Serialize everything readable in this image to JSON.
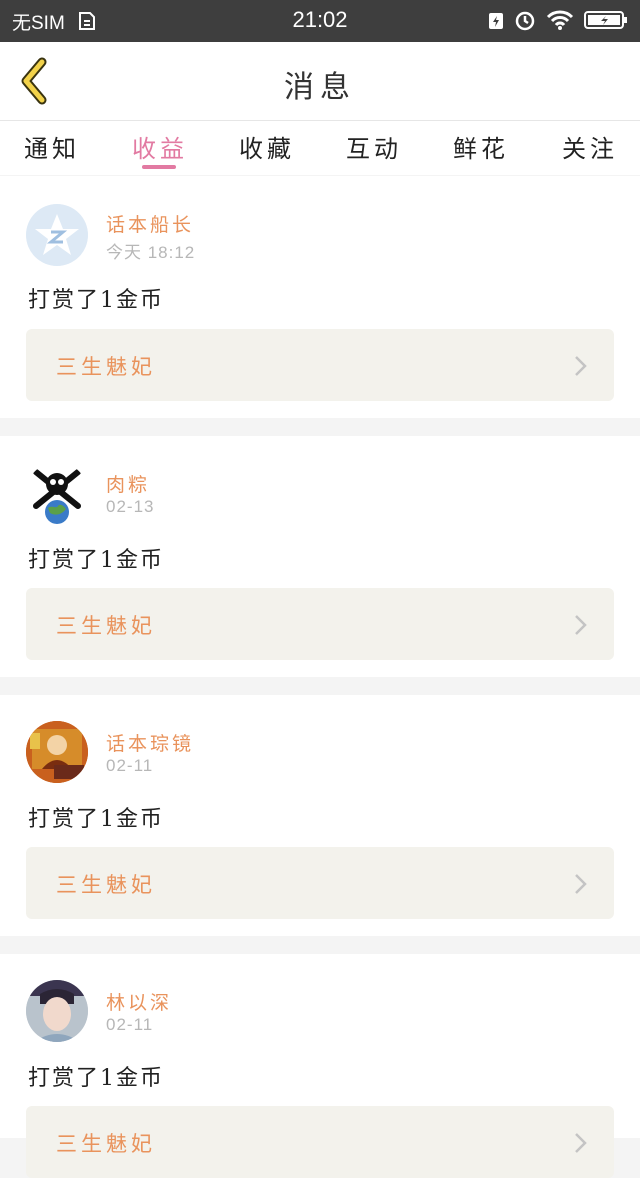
{
  "status_bar": {
    "carrier": "无SIM",
    "time": "21:02"
  },
  "header": {
    "title": "消息"
  },
  "tabs": [
    {
      "label": "通知"
    },
    {
      "label": "收益"
    },
    {
      "label": "收藏"
    },
    {
      "label": "互动"
    },
    {
      "label": "鲜花"
    },
    {
      "label": "关注"
    }
  ],
  "active_tab_index": 1,
  "messages": [
    {
      "user": "话本船长",
      "time": "今天 18:12",
      "text": "打赏了1金币",
      "book": "三生魅妃"
    },
    {
      "user": "肉粽",
      "time": "02-13",
      "text": "打赏了1金币",
      "book": "三生魅妃"
    },
    {
      "user": "话本琮镜",
      "time": "02-11",
      "text": "打赏了1金币",
      "book": "三生魅妃"
    },
    {
      "user": "林以深",
      "time": "02-11",
      "text": "打赏了1金币",
      "book": "三生魅妃"
    }
  ],
  "colors": {
    "accent_pink": "#e27aa2",
    "username_orange": "#e9935c",
    "status_bar_bg": "#3e3e3e"
  }
}
